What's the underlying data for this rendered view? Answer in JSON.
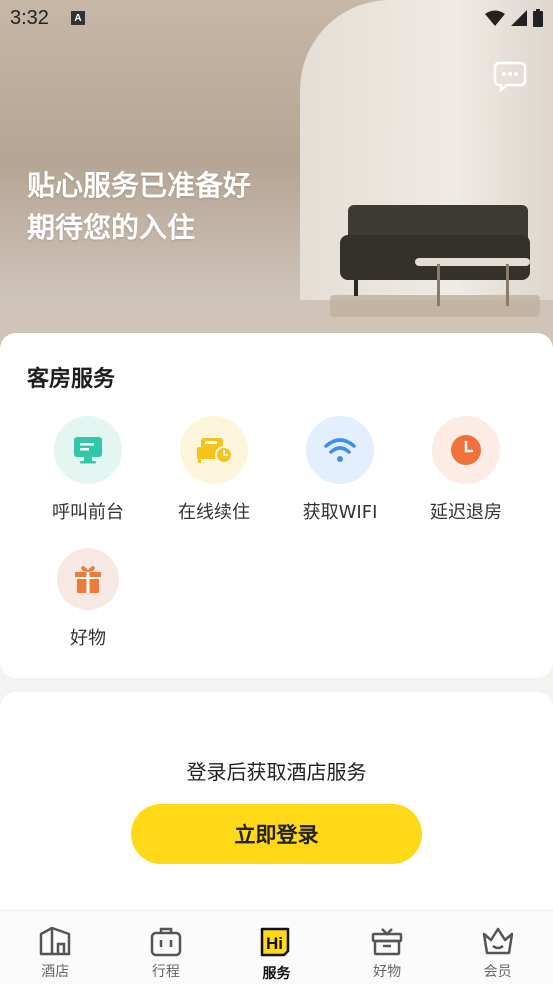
{
  "status_bar": {
    "time": "3:32"
  },
  "hero": {
    "title_line1": "贴心服务已准备好",
    "title_line2": "期待您的入住"
  },
  "room_services": {
    "title": "客房服务",
    "items": [
      {
        "label": "呼叫前台",
        "icon": "front-desk-icon",
        "bg": "#e3f6f1",
        "color": "#2fc9a8"
      },
      {
        "label": "在线续住",
        "icon": "bed-clock-icon",
        "bg": "#fdf5dc",
        "color": "#f6c21c"
      },
      {
        "label": "获取WIFI",
        "icon": "wifi-icon",
        "bg": "#e3effd",
        "color": "#3d8ef0"
      },
      {
        "label": "延迟退房",
        "icon": "clock-icon",
        "bg": "#fdece6",
        "color": "#f2713a"
      },
      {
        "label": "好物",
        "icon": "gift-icon",
        "bg": "#f8e8e4",
        "color": "#f07a3a"
      }
    ]
  },
  "login": {
    "prompt": "登录后获取酒店服务",
    "button_label": "立即登录"
  },
  "colors": {
    "accent": "#ffd917"
  },
  "tabbar": {
    "tabs": [
      {
        "label": "酒店",
        "icon": "hotel-icon"
      },
      {
        "label": "行程",
        "icon": "trip-icon"
      },
      {
        "label": "服务",
        "icon": "hi-service-icon",
        "active": true
      },
      {
        "label": "好物",
        "icon": "gift-box-icon"
      },
      {
        "label": "会员",
        "icon": "member-crown-icon"
      }
    ]
  }
}
